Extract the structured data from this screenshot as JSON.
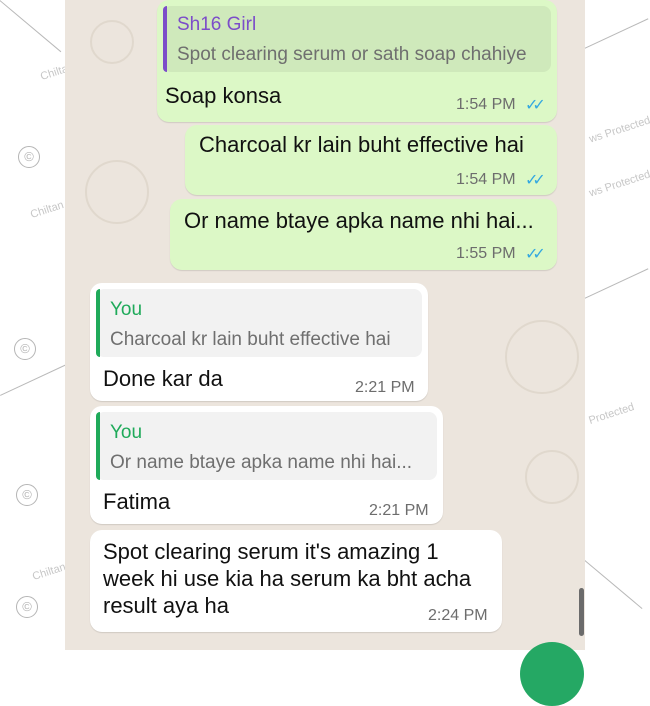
{
  "watermark": {
    "brand_left": "Chiltan",
    "brand_right": "Protected",
    "brand_right_full": "ws Protected",
    "copyright": "©"
  },
  "messages": [
    {
      "direction": "out",
      "quote": {
        "author": "Sh16 Girl",
        "text": "Spot clearing serum or sath soap chahiye",
        "author_color": "#7c4dc9"
      },
      "text": "Soap konsa",
      "time": "1:54 PM",
      "ticks": "✓✓"
    },
    {
      "direction": "out",
      "text": "Charcoal kr lain buht effective hai",
      "time": "1:54 PM",
      "ticks": "✓✓"
    },
    {
      "direction": "out",
      "text": "Or name btaye apka name nhi hai...",
      "time": "1:55 PM",
      "ticks": "✓✓"
    },
    {
      "direction": "in",
      "quote": {
        "author": "You",
        "text": "Charcoal kr lain buht effective hai",
        "author_color": "#1faa5a"
      },
      "text": "Done kar da",
      "time": "2:21 PM"
    },
    {
      "direction": "in",
      "quote": {
        "author": "You",
        "text": "Or name btaye apka name nhi hai...",
        "author_color": "#1faa5a"
      },
      "text": "Fatima",
      "time": "2:21 PM"
    },
    {
      "direction": "in",
      "text_lines": [
        "Spot clearing serum it's amazing 1",
        "week hi use kia ha serum ka bht acha",
        "result aya ha"
      ],
      "time": "2:24 PM"
    }
  ],
  "colors": {
    "outgoing_bubble": "#dcf8c6",
    "incoming_bubble": "#ffffff",
    "chat_background": "#ece5dd",
    "read_ticks": "#34a8e0"
  }
}
